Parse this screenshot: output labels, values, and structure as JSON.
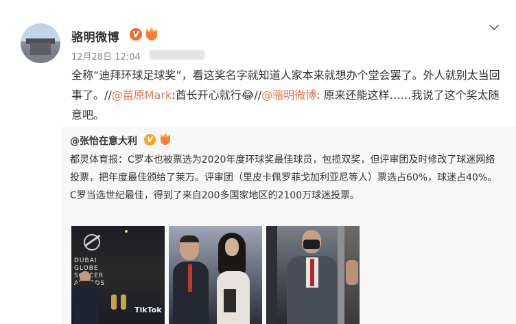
{
  "post": {
    "username": "骆明微博",
    "verified_badge": "V",
    "fan_badge_icon": "fan-crown-icon",
    "timestamp": "12月28日 12:04",
    "text_before_mention1": "全称“迪拜环球足球奖”，看这奖名字就知道人家本来就想办个堂会罢了。外人就别太当回事了。//",
    "mention1": "@苗原Mark",
    "text_between": ":酋长开心就行😂//",
    "mention2": "@骆明微博",
    "text_after_mention2": ": 原来还能这样……我说了这个奖太随意吧。"
  },
  "repost": {
    "username": "@张怡在意大利",
    "verified_badge": "V",
    "paragraph1": "都灵体育报：C罗本也被票选为2020年度环球奖最佳球员，包揽双奖，但评审团及时修改了球迷网络投票，把年度最佳颁给了莱万。评审团（里皮卡佩罗菲戈加利亚尼等人）票选占60%，球迷占40%。",
    "paragraph2": "C罗当选世纪最佳，得到了来自200多国家地区的2100万球迷投票。",
    "image1_text": "DUBAI GLOBE SOCCER AWARDS",
    "image1_brand": "TikTok"
  },
  "colors": {
    "mention": "#eb7350",
    "verified_orange": "#f26d2b",
    "verified_gold": "#f5a623",
    "repost_bg": "#f7f7f7"
  }
}
